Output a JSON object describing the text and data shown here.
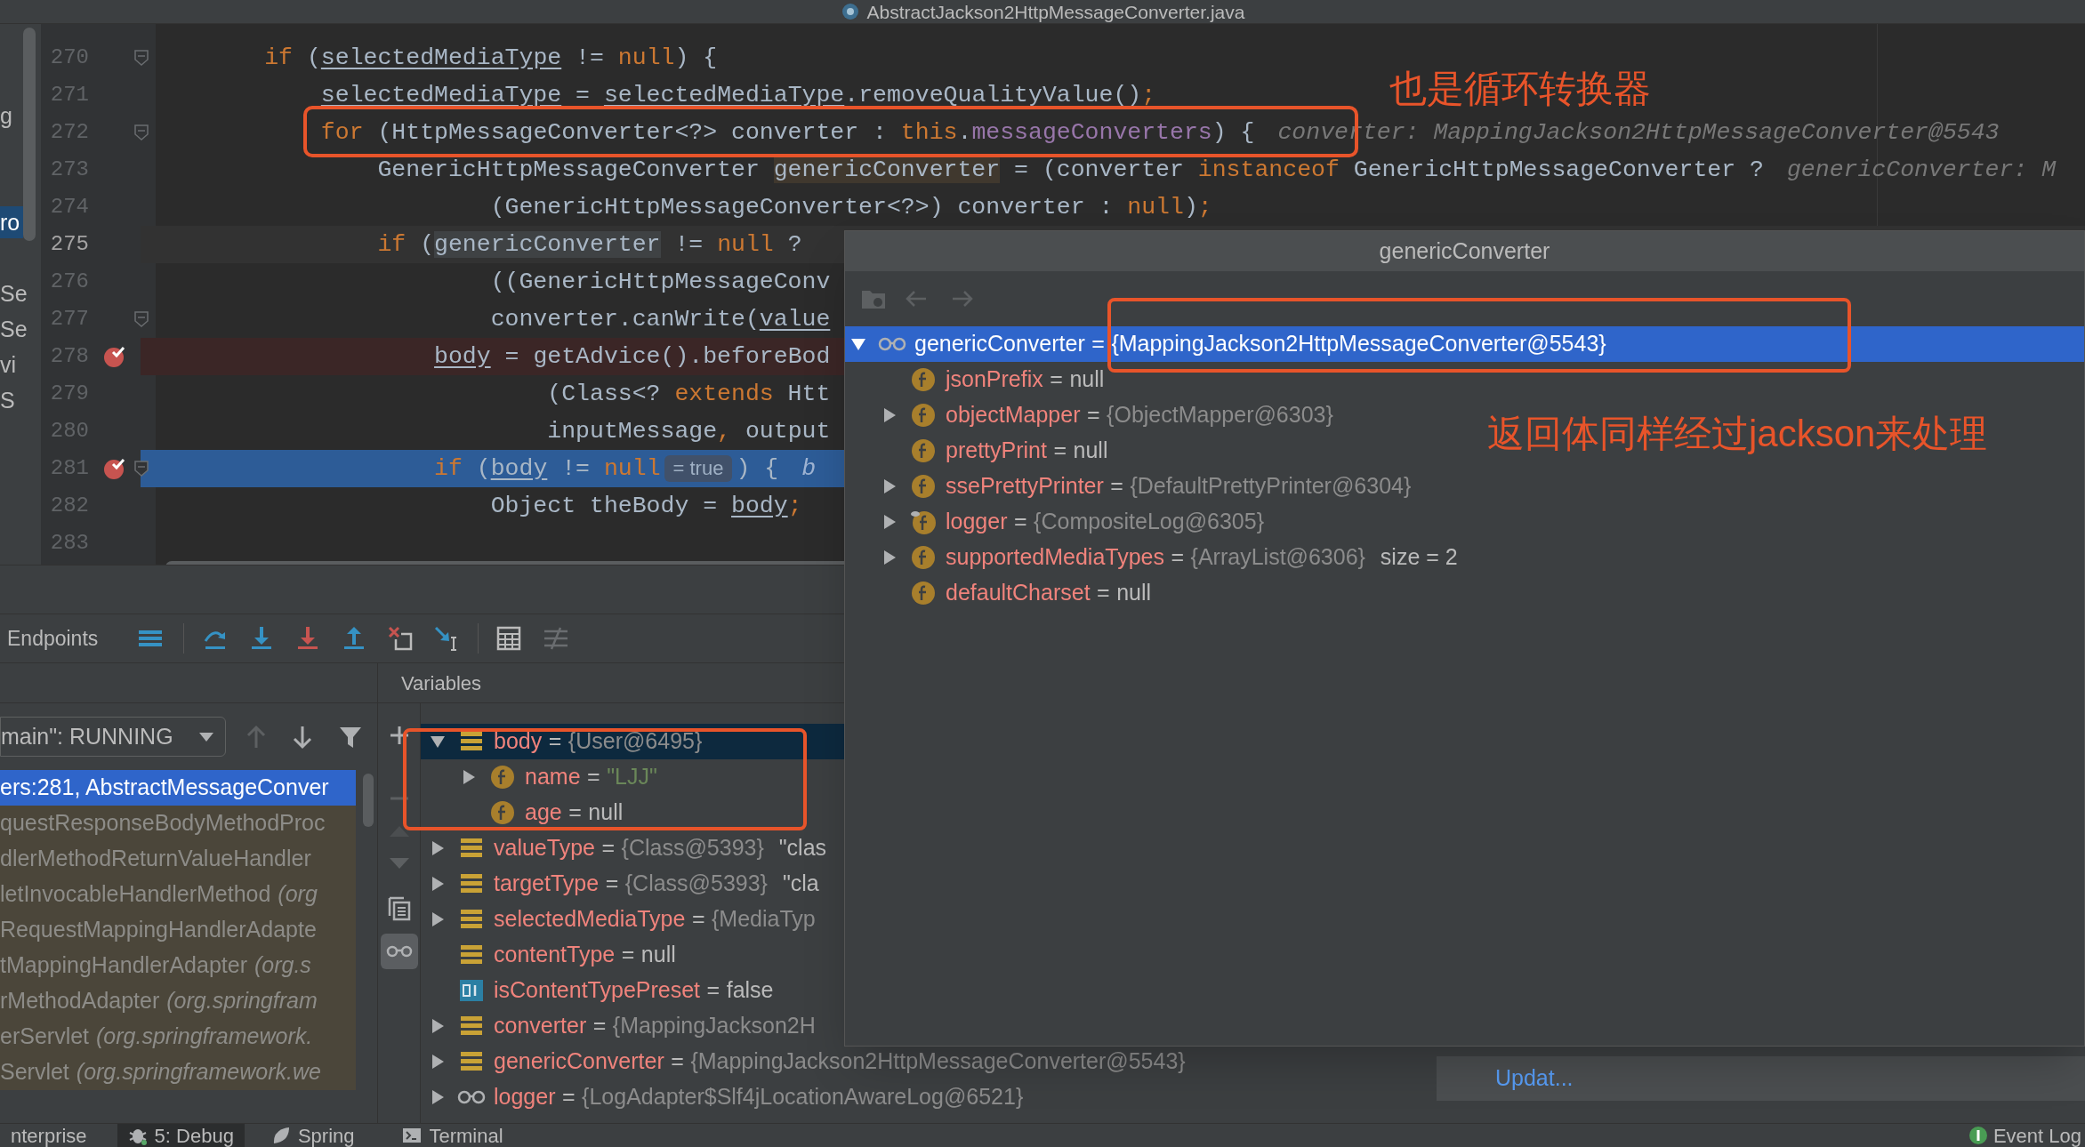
{
  "title_bar": {
    "file_name": "AbstractJackson2HttpMessageConverter.java"
  },
  "project_tree": {
    "items": [
      {
        "text": "g",
        "selected": false
      },
      {
        "text": "ro",
        "selected": true
      },
      {
        "text": "Se",
        "selected": false
      },
      {
        "text": "Se",
        "selected": false
      },
      {
        "text": "vi",
        "selected": false
      },
      {
        "text": "S",
        "selected": false
      }
    ]
  },
  "editor": {
    "lines": [
      {
        "number": "270",
        "fold": true,
        "breakpoint": false,
        "execution": false,
        "current": false,
        "segments": [
          {
            "kind": "code",
            "tokens": [
              {
                "text": "        if",
                "kind": "keyword"
              },
              {
                "text": " (",
                "kind": "plain"
              },
              {
                "text": "selectedMediaType",
                "kind": "var"
              },
              {
                "text": " != ",
                "kind": "plain"
              },
              {
                "text": "null",
                "kind": "keyword"
              },
              {
                "text": ") {",
                "kind": "plain"
              }
            ]
          }
        ]
      },
      {
        "number": "271",
        "fold": false,
        "breakpoint": false,
        "execution": false,
        "current": false,
        "segments": [
          {
            "kind": "code",
            "tokens": [
              {
                "text": "            selectedMediaType",
                "kind": "var"
              },
              {
                "text": " = ",
                "kind": "plain"
              },
              {
                "text": "selectedMediaType",
                "kind": "var"
              },
              {
                "text": ".removeQualityValue()",
                "kind": "plain"
              },
              {
                "text": ";",
                "kind": "keyword"
              }
            ]
          }
        ]
      },
      {
        "number": "272",
        "fold": true,
        "breakpoint": false,
        "execution": false,
        "current": false,
        "segments": [
          {
            "kind": "code",
            "tokens": [
              {
                "text": "            for",
                "kind": "keyword"
              },
              {
                "text": " (HttpMessageConverter<?> converter : ",
                "kind": "plain"
              },
              {
                "text": "this",
                "kind": "keyword"
              },
              {
                "text": ".",
                "kind": "plain"
              },
              {
                "text": "messageConverters",
                "kind": "field"
              },
              {
                "text": ") {",
                "kind": "plain"
              }
            ]
          },
          {
            "kind": "hint",
            "text": "converter: MappingJackson2HttpMessageConverter@5543"
          }
        ]
      },
      {
        "number": "273",
        "fold": false,
        "breakpoint": false,
        "execution": false,
        "current": false,
        "segments": [
          {
            "kind": "code",
            "tokens": [
              {
                "text": "                GenericHttpMessageConverter ",
                "kind": "plain"
              },
              {
                "text": "genericConverter",
                "kind": "decl"
              },
              {
                "text": " = (converter ",
                "kind": "plain"
              },
              {
                "text": "instanceof",
                "kind": "keyword"
              },
              {
                "text": " GenericHttpMessageConverter ?",
                "kind": "plain"
              }
            ]
          },
          {
            "kind": "hint",
            "text": "genericConverter: M"
          }
        ]
      },
      {
        "number": "274",
        "fold": false,
        "breakpoint": false,
        "execution": false,
        "current": false,
        "segments": [
          {
            "kind": "code",
            "tokens": [
              {
                "text": "                        (GenericHttpMessageConverter<?>) converter : ",
                "kind": "plain"
              },
              {
                "text": "null",
                "kind": "keyword"
              },
              {
                "text": ")",
                "kind": "plain"
              },
              {
                "text": ";",
                "kind": "keyword"
              }
            ]
          }
        ]
      },
      {
        "number": "275",
        "fold": false,
        "breakpoint": false,
        "execution": false,
        "current": true,
        "segments": [
          {
            "kind": "code",
            "tokens": [
              {
                "text": "                if",
                "kind": "keyword"
              },
              {
                "text": " (",
                "kind": "plain"
              },
              {
                "text": "genericConverter",
                "kind": "usage"
              },
              {
                "text": " != ",
                "kind": "plain"
              },
              {
                "text": "null",
                "kind": "keyword"
              },
              {
                "text": " ?",
                "kind": "plain"
              }
            ]
          }
        ]
      },
      {
        "number": "276",
        "fold": false,
        "breakpoint": false,
        "execution": false,
        "current": false,
        "segments": [
          {
            "kind": "code",
            "tokens": [
              {
                "text": "                        ((GenericHttpMessageConv",
                "kind": "plain"
              }
            ]
          }
        ]
      },
      {
        "number": "277",
        "fold": true,
        "breakpoint": false,
        "execution": false,
        "current": false,
        "segments": [
          {
            "kind": "code",
            "tokens": [
              {
                "text": "                        converter.canWrite(",
                "kind": "plain"
              },
              {
                "text": "value",
                "kind": "var"
              }
            ]
          }
        ]
      },
      {
        "number": "278",
        "fold": false,
        "breakpoint": true,
        "execution": false,
        "current": false,
        "segments": [
          {
            "kind": "code",
            "tokens": [
              {
                "text": "                    body",
                "kind": "var"
              },
              {
                "text": " = getAdvice().beforeBod",
                "kind": "plain"
              }
            ]
          }
        ]
      },
      {
        "number": "279",
        "fold": false,
        "breakpoint": false,
        "execution": false,
        "current": false,
        "segments": [
          {
            "kind": "code",
            "tokens": [
              {
                "text": "                            (Class<? ",
                "kind": "plain"
              },
              {
                "text": "extends",
                "kind": "keyword"
              },
              {
                "text": " Htt",
                "kind": "plain"
              }
            ]
          }
        ]
      },
      {
        "number": "280",
        "fold": false,
        "breakpoint": false,
        "execution": false,
        "current": false,
        "segments": [
          {
            "kind": "code",
            "tokens": [
              {
                "text": "                            inputMessage",
                "kind": "plain"
              },
              {
                "text": ",",
                "kind": "keyword"
              },
              {
                "text": " output",
                "kind": "plain"
              }
            ]
          }
        ]
      },
      {
        "number": "281",
        "fold": true,
        "breakpoint": true,
        "execution": true,
        "current": false,
        "segments": [
          {
            "kind": "code",
            "tokens": [
              {
                "text": "                    if",
                "kind": "keyword"
              },
              {
                "text": " (",
                "kind": "plain"
              },
              {
                "text": "body",
                "kind": "var"
              },
              {
                "text": " != ",
                "kind": "plain"
              },
              {
                "text": "null",
                "kind": "keyword"
              }
            ]
          },
          {
            "kind": "inlay",
            "text": "= true"
          },
          {
            "kind": "code",
            "tokens": [
              {
                "text": ") {",
                "kind": "plain"
              }
            ]
          },
          {
            "kind": "hint",
            "text": "b"
          }
        ]
      },
      {
        "number": "282",
        "fold": false,
        "breakpoint": false,
        "execution": false,
        "current": false,
        "segments": [
          {
            "kind": "code",
            "tokens": [
              {
                "text": "                        Object theBody = ",
                "kind": "plain"
              },
              {
                "text": "body",
                "kind": "var"
              },
              {
                "text": ";",
                "kind": "keyword"
              }
            ]
          }
        ]
      },
      {
        "number": "283",
        "fold": false,
        "breakpoint": false,
        "execution": false,
        "current": false
      }
    ]
  },
  "annotations": [
    {
      "text": "也是循环转换器"
    },
    {
      "text": "返回体同样经过jackson来处理"
    }
  ],
  "debug_panel": {
    "toolbar_label": "Endpoints",
    "thread": "main\": RUNNING",
    "frames": [
      {
        "text": "ers:281, AbstractMessageConver",
        "selected": true,
        "library": false
      },
      {
        "text": "questResponseBodyMethodProc",
        "selected": false,
        "library": true
      },
      {
        "text": "dlerMethodReturnValueHandler",
        "selected": false,
        "library": true
      },
      {
        "text": "letInvocableHandlerMethod *(org*",
        "selected": false,
        "library": true
      },
      {
        "text": "RequestMappingHandlerAdapte",
        "selected": false,
        "library": true
      },
      {
        "text": "tMappingHandlerAdapter *(org.s*",
        "selected": false,
        "library": true
      },
      {
        "text": "rMethodAdapter *(org.springfram*",
        "selected": false,
        "library": true
      },
      {
        "text": "erServlet *(org.springframework.*",
        "selected": false,
        "library": true
      },
      {
        "text": "Servlet *(org.springframework.we*",
        "selected": false,
        "library": true
      }
    ],
    "variables_title": "Variables",
    "watch_toggle": {
      "selected": true
    },
    "variables": [
      {
        "kind": "local",
        "name": "body",
        "sign": "=",
        "value": {
          "kind": "object",
          "text": "{User@6495}"
        },
        "expanded": true,
        "selected": true,
        "children": [
          {
            "kind": "field",
            "name": "name",
            "sign": "=",
            "value": {
              "kind": "string",
              "text": "\"LJJ\""
            },
            "expanded": false,
            "selected": false
          },
          {
            "kind": "field",
            "name": "age",
            "sign": "=",
            "value": {
              "kind": "literal",
              "text": "null"
            },
            "selected": false
          }
        ]
      },
      {
        "kind": "local",
        "name": "valueType",
        "sign": "=",
        "value": {
          "kind": "object",
          "text": "{Class@5393}"
        },
        "extra": "\"clas",
        "expanded": false,
        "selected": false
      },
      {
        "kind": "local",
        "name": "targetType",
        "sign": "=",
        "value": {
          "kind": "object",
          "text": "{Class@5393}"
        },
        "extra": "\"cla",
        "expanded": false,
        "selected": false
      },
      {
        "kind": "local",
        "name": "selectedMediaType",
        "sign": "=",
        "value": {
          "kind": "object",
          "text": "{MediaTyp"
        },
        "expanded": false,
        "selected": false
      },
      {
        "kind": "local",
        "name": "contentType",
        "sign": "=",
        "value": {
          "kind": "literal",
          "text": "null"
        },
        "selected": false
      },
      {
        "kind": "primitive",
        "name": "isContentTypePreset",
        "sign": "=",
        "value": {
          "kind": "literal",
          "text": "false"
        },
        "selected": false
      },
      {
        "kind": "local",
        "name": "converter",
        "sign": "=",
        "value": {
          "kind": "object",
          "text": "{MappingJackson2H"
        },
        "expanded": false,
        "selected": false
      },
      {
        "kind": "local",
        "name": "genericConverter",
        "sign": "=",
        "value": {
          "kind": "object",
          "text": "{MappingJackson2HttpMessageConverter@5543}"
        },
        "expanded": false,
        "selected": false
      },
      {
        "kind": "watch",
        "name": "logger",
        "sign": "=",
        "value": {
          "kind": "object",
          "text": "{LogAdapter$Slf4jLocationAwareLog@6521}"
        },
        "expanded": false,
        "selected": false
      }
    ]
  },
  "inspect_popup": {
    "title": "genericConverter",
    "root": {
      "kind": "watch",
      "name": "genericConverter",
      "sign": "=",
      "value": {
        "kind": "object",
        "text": "{MappingJackson2HttpMessageConverter@5543}"
      },
      "expanded": true,
      "selected": true,
      "children": [
        {
          "kind": "field",
          "name": "jsonPrefix",
          "sign": "=",
          "value": {
            "kind": "literal",
            "text": "null"
          },
          "selected": false
        },
        {
          "kind": "field",
          "name": "objectMapper",
          "sign": "=",
          "value": {
            "kind": "object",
            "text": "{ObjectMapper@6303}"
          },
          "expanded": false,
          "selected": false
        },
        {
          "kind": "field",
          "name": "prettyPrint",
          "sign": "=",
          "value": {
            "kind": "literal",
            "text": "null"
          },
          "selected": false
        },
        {
          "kind": "field",
          "name": "ssePrettyPrinter",
          "sign": "=",
          "value": {
            "kind": "object",
            "text": "{DefaultPrettyPrinter@6304}"
          },
          "expanded": false,
          "selected": false
        },
        {
          "kind": "field_marked",
          "name": "logger",
          "sign": "=",
          "value": {
            "kind": "object",
            "text": "{CompositeLog@6305}"
          },
          "expanded": false,
          "selected": false
        },
        {
          "kind": "field",
          "name": "supportedMediaTypes",
          "sign": "=",
          "value": {
            "kind": "object",
            "text": "{ArrayList@6306}"
          },
          "extra": "size = 2",
          "expanded": false,
          "selected": false
        },
        {
          "kind": "field",
          "name": "defaultCharset",
          "sign": "=",
          "value": {
            "kind": "literal",
            "text": "null"
          },
          "selected": false
        }
      ]
    }
  },
  "notification": {
    "link": "Updat..."
  },
  "bottom_bar": {
    "tabs": [
      {
        "label": "nterprise",
        "selected": false
      },
      {
        "label": "5: Debug",
        "selected": true
      },
      {
        "label": "Spring",
        "selected": false
      },
      {
        "label": "Terminal",
        "selected": false
      }
    ],
    "event_log": "Event Log"
  }
}
